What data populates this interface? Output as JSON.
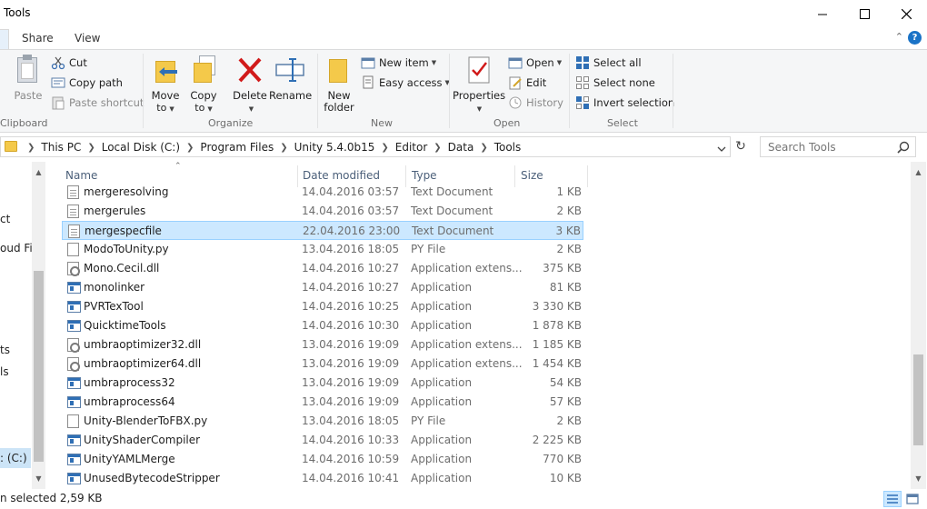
{
  "window": {
    "title": "Tools"
  },
  "ribbon_tabs": [
    "Share",
    "View"
  ],
  "ribbon": {
    "clipboard": {
      "label": "Clipboard",
      "paste": "Paste",
      "cut": "Cut",
      "copy_path": "Copy path",
      "paste_shortcut": "Paste shortcut"
    },
    "organize": {
      "label": "Organize",
      "move_to": [
        "Move",
        "to"
      ],
      "copy_to": [
        "Copy",
        "to"
      ],
      "delete": "Delete",
      "rename": "Rename"
    },
    "new": {
      "label": "New",
      "new_folder": [
        "New",
        "folder"
      ],
      "new_item": "New item",
      "easy_access": "Easy access"
    },
    "open": {
      "label": "Open",
      "properties": "Properties",
      "open": "Open",
      "edit": "Edit",
      "history": "History"
    },
    "select": {
      "label": "Select",
      "select_all": "Select all",
      "select_none": "Select none",
      "invert_selection": "Invert selection"
    }
  },
  "address": {
    "crumbs": [
      "This PC",
      "Local Disk (C:)",
      "Program Files",
      "Unity 5.4.0b15",
      "Editor",
      "Data",
      "Tools"
    ]
  },
  "search": {
    "placeholder": "Search Tools"
  },
  "nav": {
    "items": [
      "ct",
      "oud Fil",
      "ts",
      "ls",
      ": (C:)"
    ]
  },
  "columns": {
    "name": "Name",
    "date": "Date modified",
    "type": "Type",
    "size": "Size"
  },
  "files": [
    {
      "name": "mergeresolving",
      "date": "14.04.2016 03:57",
      "type": "Text Document",
      "size": "1 KB",
      "icon": "doc"
    },
    {
      "name": "mergerules",
      "date": "14.04.2016 03:57",
      "type": "Text Document",
      "size": "2 KB",
      "icon": "doc"
    },
    {
      "name": "mergespecfile",
      "date": "22.04.2016 23:00",
      "type": "Text Document",
      "size": "3 KB",
      "icon": "doc",
      "selected": true
    },
    {
      "name": "ModoToUnity.py",
      "date": "13.04.2016 18:05",
      "type": "PY File",
      "size": "2 KB",
      "icon": "blank"
    },
    {
      "name": "Mono.Cecil.dll",
      "date": "14.04.2016 10:27",
      "type": "Application extens...",
      "size": "375 KB",
      "icon": "dll"
    },
    {
      "name": "monolinker",
      "date": "14.04.2016 10:27",
      "type": "Application",
      "size": "81 KB",
      "icon": "app"
    },
    {
      "name": "PVRTexTool",
      "date": "14.04.2016 10:25",
      "type": "Application",
      "size": "3 330 KB",
      "icon": "app"
    },
    {
      "name": "QuicktimeTools",
      "date": "14.04.2016 10:30",
      "type": "Application",
      "size": "1 878 KB",
      "icon": "app"
    },
    {
      "name": "umbraoptimizer32.dll",
      "date": "13.04.2016 19:09",
      "type": "Application extens...",
      "size": "1 185 KB",
      "icon": "dll"
    },
    {
      "name": "umbraoptimizer64.dll",
      "date": "13.04.2016 19:09",
      "type": "Application extens...",
      "size": "1 454 KB",
      "icon": "dll"
    },
    {
      "name": "umbraprocess32",
      "date": "13.04.2016 19:09",
      "type": "Application",
      "size": "54 KB",
      "icon": "app"
    },
    {
      "name": "umbraprocess64",
      "date": "13.04.2016 19:09",
      "type": "Application",
      "size": "57 KB",
      "icon": "app"
    },
    {
      "name": "Unity-BlenderToFBX.py",
      "date": "13.04.2016 18:05",
      "type": "PY File",
      "size": "2 KB",
      "icon": "blank"
    },
    {
      "name": "UnityShaderCompiler",
      "date": "14.04.2016 10:33",
      "type": "Application",
      "size": "2 225 KB",
      "icon": "app"
    },
    {
      "name": "UnityYAMLMerge",
      "date": "14.04.2016 10:59",
      "type": "Application",
      "size": "770 KB",
      "icon": "app"
    },
    {
      "name": "UnusedBytecodeStripper",
      "date": "14.04.2016 10:41",
      "type": "Application",
      "size": "10 KB",
      "icon": "app"
    }
  ],
  "status": {
    "text": "n selected  2,59 KB"
  },
  "colors": {
    "accent": "#1a73c7",
    "selection": "#cce8ff",
    "selection_border": "#99d1ff"
  }
}
